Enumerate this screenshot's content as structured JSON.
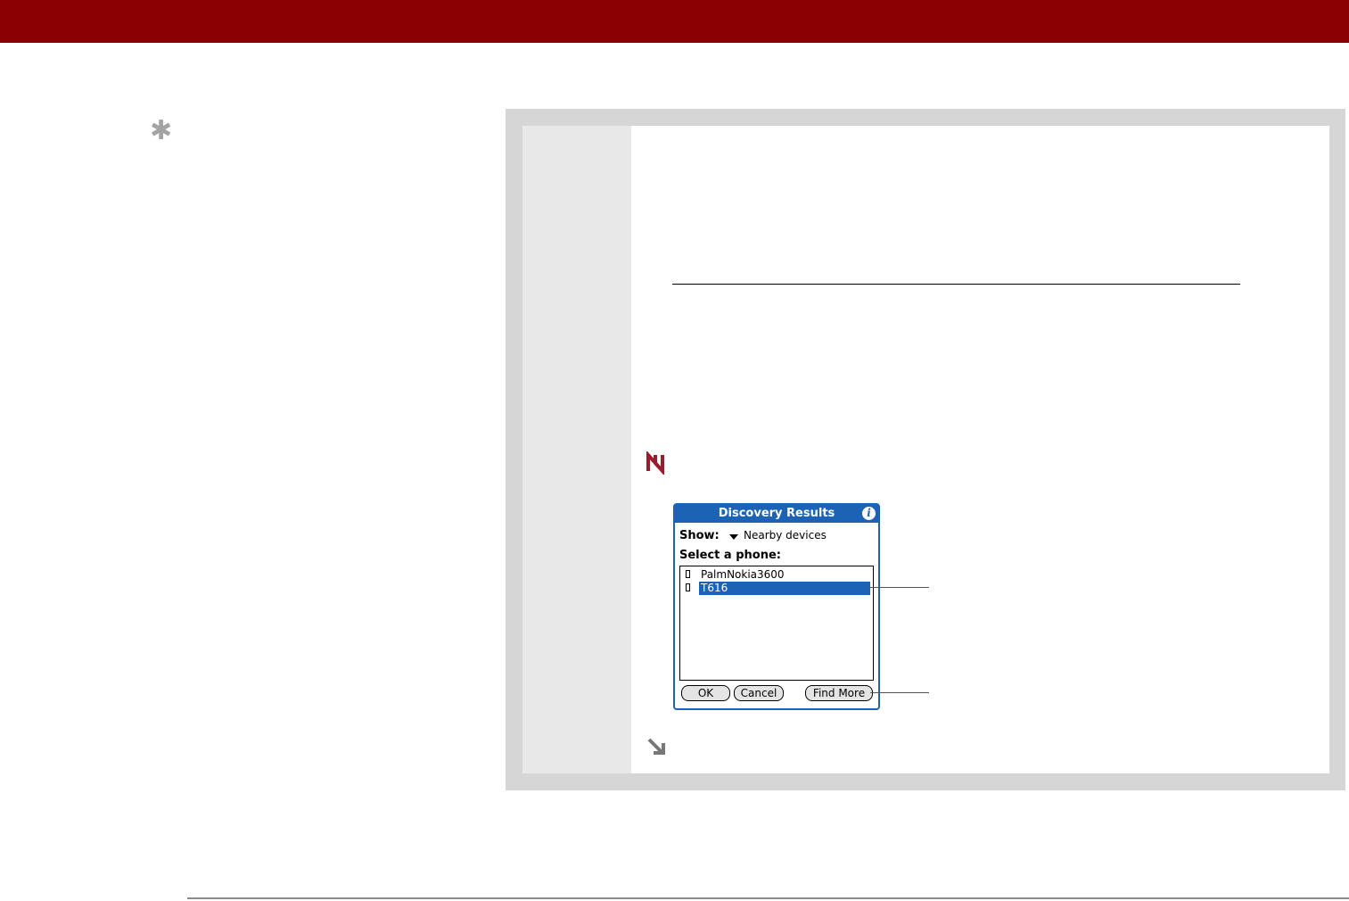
{
  "icons": {
    "tip": "asterisk-icon",
    "steps": "steps-icon",
    "continued": "continued-arrow-icon"
  },
  "colors": {
    "header_bar": "#8b0000",
    "frame": "#d6d6d6",
    "palm_blue": "#1d63b5"
  },
  "tip_glyph": "✱",
  "palm": {
    "title": "Discovery Results",
    "info_glyph": "i",
    "show_label": "Show:",
    "show_value": "Nearby devices",
    "list_label": "Select a phone:",
    "items": [
      {
        "name": "PalmNokia3600",
        "selected": false
      },
      {
        "name": "T616",
        "selected": true
      }
    ],
    "buttons": {
      "ok": "OK",
      "cancel": "Cancel",
      "find_more": "Find More"
    }
  }
}
